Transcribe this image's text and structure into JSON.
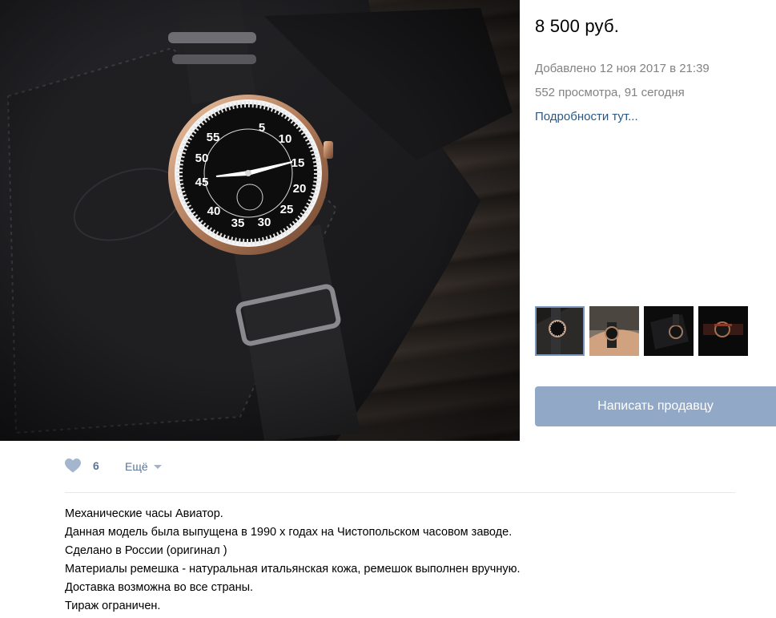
{
  "item": {
    "price": "8 500 руб.",
    "added": "Добавлено 12 ноя 2017 в 21:39",
    "views": "552 просмотра, 91 сегодня",
    "details_link": "Подробности тут..."
  },
  "photo": {
    "dial_numbers": [
      "5",
      "10",
      "15",
      "20",
      "25",
      "30",
      "35",
      "40",
      "45",
      "50",
      "55"
    ]
  },
  "thumbnails": [
    {
      "icon": "watch-photo",
      "active": true
    },
    {
      "icon": "watch-on-wrist-photo",
      "active": false
    },
    {
      "icon": "watch-on-leather-photo",
      "active": false
    },
    {
      "icon": "watch-dark-photo",
      "active": false
    }
  ],
  "contact_button": "Написать продавцу",
  "actions": {
    "like_count": "6",
    "more_label": "Ещё"
  },
  "description": [
    "Механические часы Авиатор.",
    "Данная модель была выпущена в 1990 х годах на Чистопольском часовом заводе.",
    "Сделано в России (оригинал )",
    "Материалы ремешка - натуральная итальянская кожа, ремешок выполнен вручную.",
    "Доставка возможна во все страны.",
    "Тираж ограничен."
  ],
  "colors": {
    "accent": "#2a5885",
    "button": "#91a8c6",
    "muted": "#828282",
    "like_icon": "#a4b6cd"
  }
}
